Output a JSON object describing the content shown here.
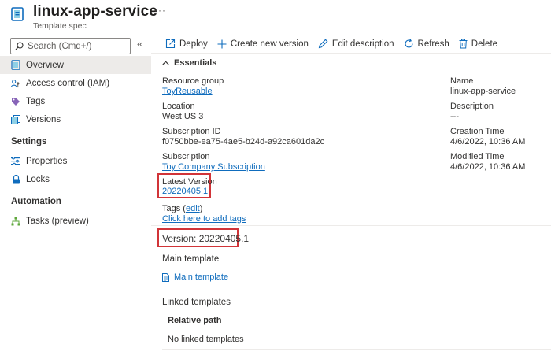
{
  "header": {
    "title": "linux-app-service",
    "subtitle": "Template spec",
    "more": "···"
  },
  "sidebar": {
    "search_placeholder": "Search (Cmd+/)",
    "collapse": "«",
    "items": [
      {
        "label": "Overview",
        "icon": "overview-icon"
      },
      {
        "label": "Access control (IAM)",
        "icon": "iam-icon"
      },
      {
        "label": "Tags",
        "icon": "tag-icon"
      },
      {
        "label": "Versions",
        "icon": "versions-icon"
      }
    ],
    "settings_title": "Settings",
    "settings_items": [
      {
        "label": "Properties",
        "icon": "properties-icon"
      },
      {
        "label": "Locks",
        "icon": "lock-icon"
      }
    ],
    "automation_title": "Automation",
    "automation_items": [
      {
        "label": "Tasks (preview)",
        "icon": "tasks-icon"
      }
    ]
  },
  "toolbar": {
    "deploy": "Deploy",
    "new_version": "Create new version",
    "edit_description": "Edit description",
    "refresh": "Refresh",
    "delete": "Delete"
  },
  "essentials": {
    "title": "Essentials",
    "left": {
      "resource_group_label": "Resource group",
      "resource_group_value": "ToyReusable",
      "location_label": "Location",
      "location_value": "West US 3",
      "subscription_id_label": "Subscription ID",
      "subscription_id_value": "f0750bbe-ea75-4ae5-b24d-a92ca601da2c",
      "subscription_label": "Subscription",
      "subscription_value": "Toy Company Subscription",
      "latest_version_label": "Latest Version",
      "latest_version_value": "20220405.1",
      "tags_label": "Tags",
      "tags_edit": "edit",
      "tags_add": "Click here to add tags"
    },
    "right": {
      "name_label": "Name",
      "name_value": "linux-app-service",
      "description_label": "Description",
      "description_value": "---",
      "creation_time_label": "Creation Time",
      "creation_time_value": "4/6/2022, 10:36 AM",
      "modified_time_label": "Modified Time",
      "modified_time_value": "4/6/2022, 10:36 AM"
    }
  },
  "version_section": {
    "version_text": "Version: 20220405.1",
    "main_template_title": "Main template",
    "main_template_link": "Main template",
    "linked_templates_title": "Linked templates",
    "table_header": "Relative path",
    "table_empty": "No linked templates"
  },
  "colors": {
    "link": "#0f6cbd",
    "highlight_box": "#d13438",
    "active_nav": "#edebe9"
  }
}
